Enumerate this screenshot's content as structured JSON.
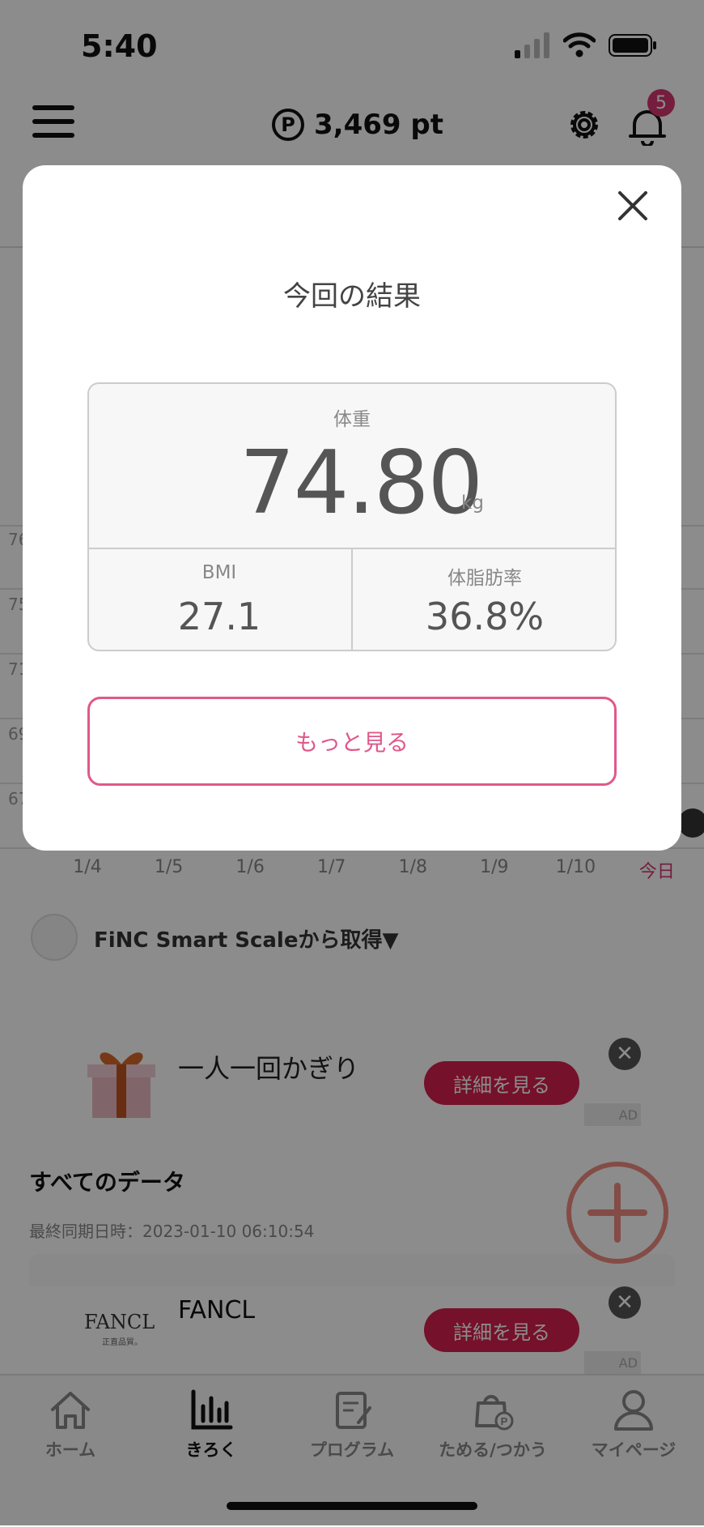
{
  "status_bar": {
    "time": "5:40"
  },
  "header": {
    "points_symbol": "P",
    "points": "3,469 pt",
    "notification_count": "5"
  },
  "chart_bg": {
    "y_ticks": [
      "76",
      "75",
      "71",
      "69",
      "67"
    ],
    "x_labels": [
      "1/4",
      "1/5",
      "1/6",
      "1/7",
      "1/8",
      "1/9",
      "1/10",
      "今日"
    ]
  },
  "source": {
    "label": "FiNC Smart Scaleから取得▼"
  },
  "ad1": {
    "text": "一人一回かぎり",
    "button": "詳細を見る",
    "tag": "AD",
    "close": "✕"
  },
  "all_data": {
    "title": "すべてのデータ",
    "sync": "最終同期日時：2023-01-10 06:10:54"
  },
  "ad2": {
    "logo": "FANCL",
    "logo_sub": "正直品質。",
    "text": "FANCL",
    "button": "詳細を見る",
    "tag": "AD",
    "close": "✕"
  },
  "tabs": [
    {
      "label": "ホーム",
      "icon": "home-icon"
    },
    {
      "label": "きろく",
      "icon": "chart-icon"
    },
    {
      "label": "プログラム",
      "icon": "program-icon"
    },
    {
      "label": "ためる/つかう",
      "icon": "bag-points-icon"
    },
    {
      "label": "マイページ",
      "icon": "person-icon"
    }
  ],
  "modal": {
    "title": "今回の結果",
    "weight_label": "体重",
    "weight_value": "74.80",
    "weight_unit": "kg",
    "bmi_label": "BMI",
    "bmi_value": "27.1",
    "body_fat_label": "体脂肪率",
    "body_fat_value": "36.8%",
    "more_button": "もっと見る"
  },
  "colors": {
    "accent": "#e0588a",
    "ad_button": "#d61f4e",
    "badge": "#d6366f"
  }
}
